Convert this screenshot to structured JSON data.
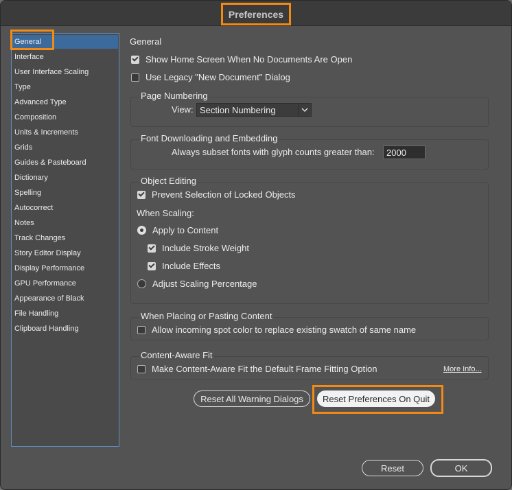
{
  "window": {
    "title": "Preferences"
  },
  "sidebar": {
    "items": [
      {
        "label": "General",
        "selected": true
      },
      {
        "label": "Interface"
      },
      {
        "label": "User Interface Scaling"
      },
      {
        "label": "Type"
      },
      {
        "label": "Advanced Type"
      },
      {
        "label": "Composition"
      },
      {
        "label": "Units & Increments"
      },
      {
        "label": "Grids"
      },
      {
        "label": "Guides & Pasteboard"
      },
      {
        "label": "Dictionary"
      },
      {
        "label": "Spelling"
      },
      {
        "label": "Autocorrect"
      },
      {
        "label": "Notes"
      },
      {
        "label": "Track Changes"
      },
      {
        "label": "Story Editor Display"
      },
      {
        "label": "Display Performance"
      },
      {
        "label": "GPU Performance"
      },
      {
        "label": "Appearance of Black"
      },
      {
        "label": "File Handling"
      },
      {
        "label": "Clipboard Handling"
      }
    ]
  },
  "main": {
    "heading": "General",
    "show_home_screen": {
      "label": "Show Home Screen When No Documents Are Open",
      "checked": true
    },
    "legacy_new_doc": {
      "label": "Use Legacy \"New Document\" Dialog",
      "checked": false
    },
    "page_numbering": {
      "title": "Page Numbering",
      "view_label": "View:",
      "view_value": "Section Numbering"
    },
    "font_downloading": {
      "title": "Font Downloading and Embedding",
      "subset_label": "Always subset fonts with glyph counts greater than:",
      "subset_value": "2000"
    },
    "object_editing": {
      "title": "Object Editing",
      "prevent_locked": {
        "label": "Prevent Selection of Locked Objects",
        "checked": true
      },
      "when_scaling": "When Scaling:",
      "apply_to_content": {
        "label": "Apply to Content",
        "selected": true
      },
      "include_stroke": {
        "label": "Include Stroke Weight",
        "checked": true
      },
      "include_effects": {
        "label": "Include Effects",
        "checked": true
      },
      "adjust_scaling": {
        "label": "Adjust Scaling Percentage",
        "selected": false
      }
    },
    "placing": {
      "title": "When Placing or Pasting Content",
      "spot_color": {
        "label": "Allow incoming spot color to replace existing swatch of same name",
        "checked": false
      }
    },
    "content_aware": {
      "title": "Content-Aware Fit",
      "default_option": {
        "label": "Make Content-Aware Fit the Default Frame Fitting Option",
        "checked": false
      },
      "more_info": "More Info..."
    },
    "reset_warnings_label": "Reset All Warning Dialogs",
    "reset_prefs_label": "Reset Preferences On Quit"
  },
  "footer": {
    "reset_label": "Reset",
    "ok_label": "OK"
  },
  "colors": {
    "highlight": "#f28a14",
    "selection": "#3c6a9c",
    "panel": "#535353"
  }
}
